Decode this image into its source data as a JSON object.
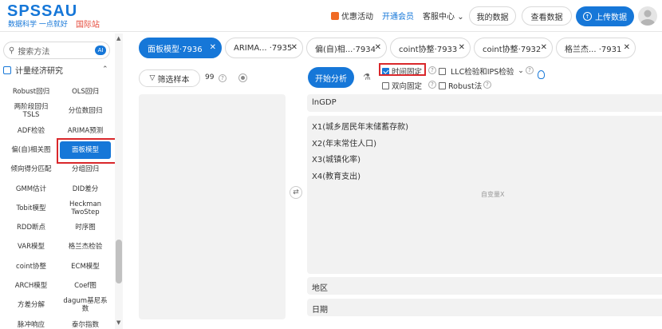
{
  "header": {
    "logo": "SPSSAU",
    "slogan": "数据科学 一点就好",
    "intl": "国际站",
    "promo": "优惠活动",
    "vip": "开通会员",
    "service": "客服中心",
    "my_data": "我的数据",
    "view_data": "查看数据",
    "upload": "上传数据"
  },
  "sidebar": {
    "search_placeholder": "搜索方法",
    "ai_badge": "AI",
    "section": "计量经济研究",
    "rows": [
      [
        "Robust回归",
        "OLS回归"
      ],
      [
        "两阶段回归\nTSLS",
        "分位数回归"
      ],
      [
        "ADF检验",
        "ARIMA预测"
      ],
      [
        "偏(自)相关图",
        "面板模型"
      ],
      [
        "倾向得分匹配",
        "分组回归"
      ],
      [
        "GMM估计",
        "DID差分"
      ],
      [
        "Tobit模型",
        "Heckman\nTwoStep"
      ],
      [
        "RDD断点",
        "时序图"
      ],
      [
        "VAR模型",
        "格兰杰检验"
      ],
      [
        "coint协整",
        "ECM模型"
      ],
      [
        "ARCH模型",
        "Coef图"
      ],
      [
        "方差分解",
        "dagum基尼系\n数"
      ],
      [
        "脉冲响应",
        "泰尔指数"
      ]
    ]
  },
  "tabs": [
    {
      "label": "面板模型·7936"
    },
    {
      "label": "ARIMA...  ·7935"
    },
    {
      "label": "偏(自)相...·7934"
    },
    {
      "label": "coint协整·7933"
    },
    {
      "label": "coint协整·7932"
    },
    {
      "label": "格兰杰...  ·7931"
    }
  ],
  "controls": {
    "filter": "筛选样本",
    "count": "99",
    "start": "开始分析",
    "fixed_time": "时间固定",
    "llc": "LLC检验和IPS检验",
    "two_way": "双向固定",
    "robust": "Robust法"
  },
  "panels": {
    "y_var": "lnGDP",
    "x_vars": [
      "X1(城乡居民年末储蓄存款)",
      "X2(年末常住人口)",
      "X3(城镇化率)",
      "X4(教育支出)"
    ],
    "x_placeholder": "自变量X",
    "region": "地区",
    "date": "日期"
  }
}
